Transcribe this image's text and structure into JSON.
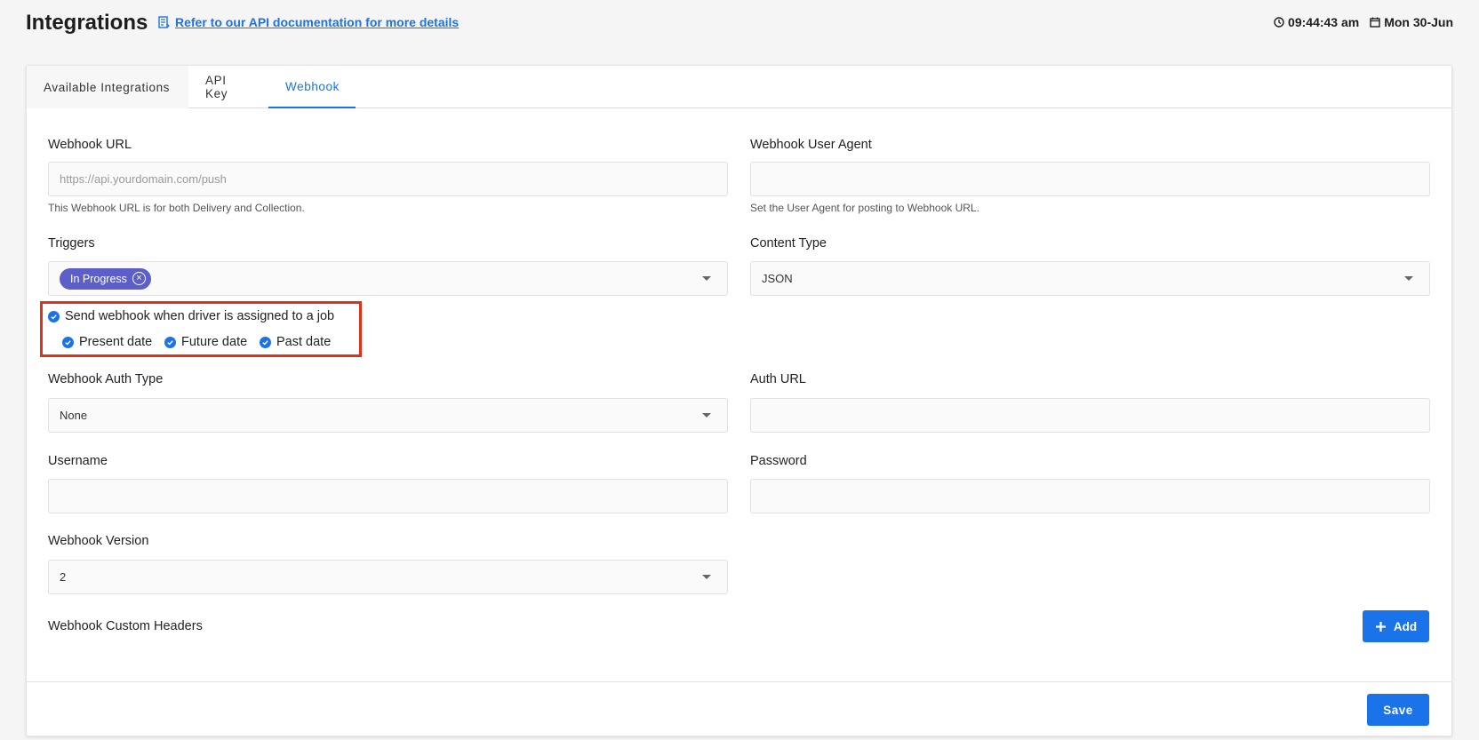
{
  "header": {
    "title": "Integrations",
    "doc_link": "Refer to our API documentation for more details",
    "time": "09:44:43 am",
    "date": "Mon 30-Jun"
  },
  "tabs": [
    {
      "label": "Available Integrations",
      "active": false
    },
    {
      "label": "API Key",
      "active": false
    },
    {
      "label": "Webhook",
      "active": true
    }
  ],
  "form": {
    "webhook_url": {
      "label": "Webhook URL",
      "value": "",
      "placeholder": "https://api.yourdomain.com/push",
      "helper": "This Webhook URL is for both Delivery and Collection."
    },
    "user_agent": {
      "label": "Webhook User Agent",
      "value": "",
      "helper": "Set the User Agent for posting to Webhook URL."
    },
    "triggers": {
      "label": "Triggers",
      "chips": [
        "In Progress"
      ]
    },
    "content_type": {
      "label": "Content Type",
      "value": "JSON"
    },
    "driver_assigned": {
      "label": "Send webhook when driver is assigned to a job",
      "checked": true,
      "options": [
        {
          "label": "Present date",
          "checked": true
        },
        {
          "label": "Future date",
          "checked": true
        },
        {
          "label": "Past date",
          "checked": true
        }
      ]
    },
    "auth_type": {
      "label": "Webhook Auth Type",
      "value": "None"
    },
    "auth_url": {
      "label": "Auth URL",
      "value": ""
    },
    "username": {
      "label": "Username",
      "value": ""
    },
    "password": {
      "label": "Password",
      "value": ""
    },
    "version": {
      "label": "Webhook Version",
      "value": "2"
    },
    "custom_headers": {
      "label": "Webhook Custom Headers",
      "add_label": "Add"
    }
  },
  "footer": {
    "save_label": "Save"
  },
  "colors": {
    "accent": "#1a73e8",
    "chip": "#5b5fc7",
    "highlight": "#e0321a"
  }
}
